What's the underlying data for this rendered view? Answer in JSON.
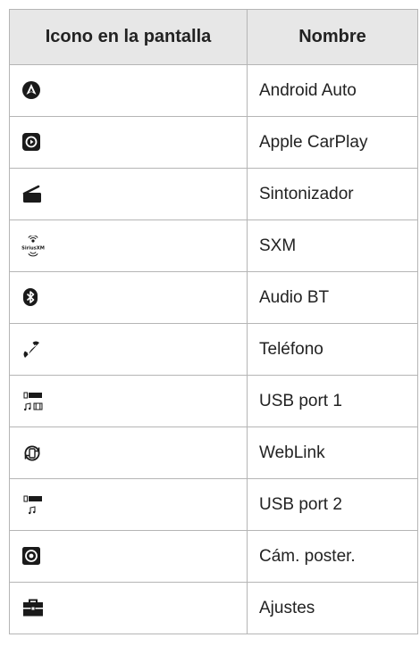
{
  "table": {
    "headers": [
      "Icono en la pantalla",
      "Nombre"
    ],
    "rows": [
      {
        "icon": "android-auto-icon",
        "name": "Android Auto"
      },
      {
        "icon": "apple-carplay-icon",
        "name": "Apple CarPlay"
      },
      {
        "icon": "tuner-icon",
        "name": "Sintonizador"
      },
      {
        "icon": "sxm-icon",
        "name": "SXM",
        "icon_text": "SiriusXM"
      },
      {
        "icon": "bluetooth-icon",
        "name": "Audio BT"
      },
      {
        "icon": "phone-icon",
        "name": "Teléfono"
      },
      {
        "icon": "usb-music-video-icon",
        "name": "USB port 1"
      },
      {
        "icon": "weblink-icon",
        "name": "WebLink"
      },
      {
        "icon": "usb-music-icon",
        "name": "USB port 2"
      },
      {
        "icon": "camera-icon",
        "name": "Cám. poster."
      },
      {
        "icon": "settings-toolbox-icon",
        "name": "Ajustes"
      }
    ]
  },
  "colors": {
    "header_bg": "#e7e7e7",
    "border": "#b5b5b5",
    "icon": "#1a1a1a"
  }
}
